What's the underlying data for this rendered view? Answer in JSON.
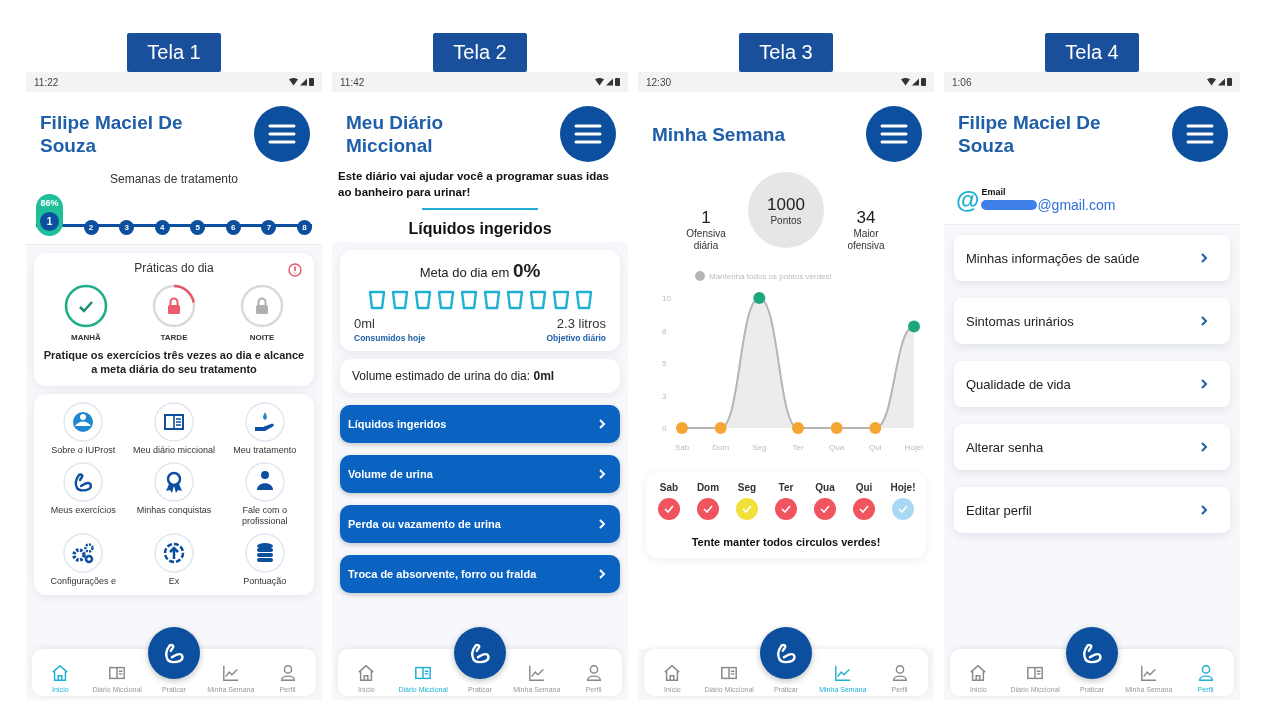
{
  "screens": [
    {
      "tag": "Tela 1",
      "kind": "home",
      "time": "11:22",
      "title": "Filipe Maciel De Souza",
      "weeks": {
        "title": "Semanas de tratamento",
        "badge": "86%",
        "steps": [
          {
            "label": "1",
            "selected": true
          },
          {
            "label": "2",
            "selected": false
          },
          {
            "label": "3",
            "selected": false
          },
          {
            "label": "4",
            "selected": false
          },
          {
            "label": "5",
            "selected": false
          },
          {
            "label": "6",
            "selected": false
          },
          {
            "label": "7",
            "selected": false
          },
          {
            "label": "8",
            "selected": false
          }
        ]
      },
      "practices": {
        "title": "Práticas do dia",
        "items": [
          {
            "label": "MANHÃ",
            "kind": "done"
          },
          {
            "label": "TARDE",
            "kind": "active"
          },
          {
            "label": "NOITE",
            "kind": "locked"
          }
        ],
        "message": "Pratique os exercícios três vezes ao dia e alcance a meta diária do seu tratamento"
      },
      "shortcuts": [
        {
          "label": "Sobre o IUProst",
          "kind": "about"
        },
        {
          "label": "Meu diário miccional",
          "kind": "diary"
        },
        {
          "label": "Meu tratamento",
          "kind": "treatment"
        },
        {
          "label": "Meus exercícios",
          "kind": "exercise"
        },
        {
          "label": "Minhas conquistas",
          "kind": "medal"
        },
        {
          "label": "Fale com o profissional",
          "kind": "contact"
        },
        {
          "label": "Configurações e",
          "kind": "settings"
        },
        {
          "label": "Ex",
          "kind": "upload"
        },
        {
          "label": "Pontuação",
          "kind": "coins"
        }
      ],
      "nav": [
        {
          "label": "Início",
          "kind": "home",
          "selected": true
        },
        {
          "label": "Diário Miccional",
          "kind": "diary",
          "selected": false
        },
        {
          "label": "Praticar",
          "kind": "fab",
          "selected": false
        },
        {
          "label": "Minha Semana",
          "kind": "chart",
          "selected": false
        },
        {
          "label": "Perfil",
          "kind": "profile",
          "selected": false
        }
      ]
    },
    {
      "tag": "Tela 2",
      "kind": "diary",
      "time": "11:42",
      "title": "Meu Diário Miccional",
      "intro": "Este diário vai ajudar você a programar suas idas ao banheiro para urinar!",
      "heading": "Líquidos ingeridos",
      "goal": {
        "title": "Meta do dia em **0%**",
        "cups": [
          {
            "filled": false
          },
          {
            "filled": false
          },
          {
            "filled": false
          },
          {
            "filled": false
          },
          {
            "filled": false
          },
          {
            "filled": false
          },
          {
            "filled": false
          },
          {
            "filled": false
          },
          {
            "filled": false
          },
          {
            "filled": false
          }
        ],
        "consumed": "0ml",
        "consumed_label": "Consumidos hoje",
        "target": "2.3 litros",
        "target_label": "Objetivo diário"
      },
      "volume": "Volume estimado de urina do dia: **0ml**",
      "actions": [
        "Líquidos ingeridos",
        "Volume de urina",
        "Perda ou vazamento de urina",
        "Troca de absorvente, forro ou fralda"
      ],
      "nav": [
        {
          "label": "Início",
          "kind": "home",
          "selected": false
        },
        {
          "label": "Diário Miccional",
          "kind": "diary",
          "selected": true
        },
        {
          "label": "Praticar",
          "kind": "fab",
          "selected": false
        },
        {
          "label": "Minha Semana",
          "kind": "chart",
          "selected": false
        },
        {
          "label": "Perfil",
          "kind": "profile",
          "selected": false
        }
      ]
    },
    {
      "tag": "Tela 3",
      "kind": "week",
      "time": "12:30",
      "title": "Minha Semana",
      "points": {
        "value": "1000",
        "label": "Pontos"
      },
      "stats": [
        {
          "value": "1",
          "label": "Ofensiva diária"
        },
        {
          "value": "34",
          "label": "Maior ofensiva"
        }
      ],
      "chart_data": {
        "type": "area",
        "categories": [
          "Sab",
          "Dom",
          "Seg",
          "Ter",
          "Qua",
          "Qui",
          "Hoje!"
        ],
        "series": [
          {
            "name": "Mantenha todos os pontos verdes!",
            "color": "#b5b5b5",
            "values": [
              0,
              0,
              10,
              0,
              0,
              0,
              7.8
            ]
          }
        ],
        "ylim": [
          0,
          10
        ],
        "yticks": [
          0,
          {
            "value": 2.5,
            "label": "3"
          },
          5,
          {
            "value": 7.5,
            "label": "8"
          },
          10
        ]
      },
      "days": [
        {
          "label": "Sab",
          "color": "#f0545f"
        },
        {
          "label": "Dom",
          "color": "#f0545f"
        },
        {
          "label": "Seg",
          "color": "#f2e03a"
        },
        {
          "label": "Ter",
          "color": "#f0545f"
        },
        {
          "label": "Qua",
          "color": "#f0545f"
        },
        {
          "label": "Qui",
          "color": "#f0545f"
        },
        {
          "label": "Hoje!",
          "color": "#a9d8f5"
        }
      ],
      "hint": "Tente manter todos circulos verdes!",
      "nav": [
        {
          "label": "Início",
          "kind": "home",
          "selected": false
        },
        {
          "label": "Diário Miccional",
          "kind": "diary",
          "selected": false
        },
        {
          "label": "Praticar",
          "kind": "fab",
          "selected": false
        },
        {
          "label": "Minha Semana",
          "kind": "chart",
          "selected": true
        },
        {
          "label": "Perfil",
          "kind": "profile",
          "selected": false
        }
      ]
    },
    {
      "tag": "Tela 4",
      "kind": "profile",
      "time": "1:06",
      "title": "Filipe Maciel De Souza",
      "email": {
        "icon": "@",
        "label": "Email",
        "value": "@gmail.com"
      },
      "menu": [
        "Minhas informações de saúde",
        "Sintomas urinários",
        "Qualidade de vida",
        "Alterar senha",
        "Editar perfil"
      ],
      "nav": [
        {
          "label": "Início",
          "kind": "home",
          "selected": false
        },
        {
          "label": "Diário Miccional",
          "kind": "diary",
          "selected": false
        },
        {
          "label": "Praticar",
          "kind": "fab",
          "selected": false
        },
        {
          "label": "Minha Semana",
          "kind": "chart",
          "selected": false
        },
        {
          "label": "Perfil",
          "kind": "profile",
          "selected": true
        }
      ]
    }
  ]
}
